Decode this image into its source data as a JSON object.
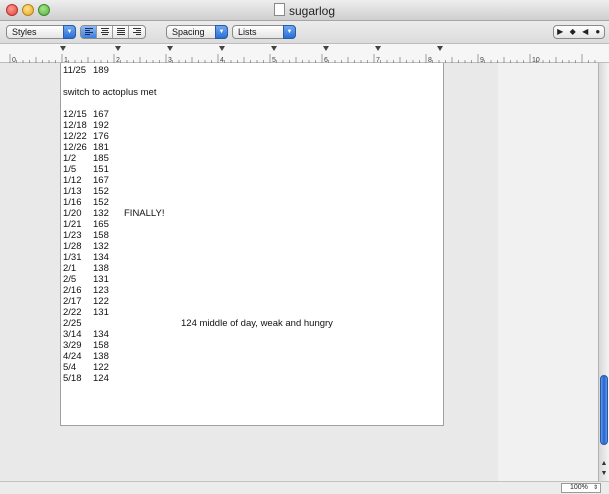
{
  "window": {
    "title": "sugarlog"
  },
  "toolbar": {
    "styles_label": "Styles",
    "spacing_label": "Spacing",
    "lists_label": "Lists",
    "nav_glyphs": [
      "▶",
      "◆",
      "◀",
      "●"
    ]
  },
  "ruler": {
    "labels": [
      "0",
      "1",
      "2",
      "3",
      "4",
      "5",
      "6",
      "7",
      "8",
      "9",
      "10"
    ]
  },
  "document": {
    "lines": [
      {
        "c1": "11/25",
        "c2": "189",
        "c3": ""
      },
      {
        "c1": "",
        "c2": "",
        "c3": ""
      },
      {
        "c1": "switch to actoplus met",
        "c2": "",
        "c3": ""
      },
      {
        "c1": "",
        "c2": "",
        "c3": ""
      },
      {
        "c1": "12/15",
        "c2": "167",
        "c3": ""
      },
      {
        "c1": "12/18",
        "c2": "192",
        "c3": ""
      },
      {
        "c1": "12/22",
        "c2": "176",
        "c3": ""
      },
      {
        "c1": "12/26",
        "c2": "181",
        "c3": ""
      },
      {
        "c1": "1/2",
        "c2": "185",
        "c3": ""
      },
      {
        "c1": "1/5",
        "c2": "151",
        "c3": ""
      },
      {
        "c1": "1/12",
        "c2": "167",
        "c3": ""
      },
      {
        "c1": "1/13",
        "c2": "152",
        "c3": ""
      },
      {
        "c1": "1/16",
        "c2": "152",
        "c3": ""
      },
      {
        "c1": "1/20",
        "c2": "132",
        "c3": "FINALLY!"
      },
      {
        "c1": "1/21",
        "c2": "165",
        "c3": ""
      },
      {
        "c1": "1/23",
        "c2": "158",
        "c3": ""
      },
      {
        "c1": "1/28",
        "c2": "132",
        "c3": ""
      },
      {
        "c1": "1/31",
        "c2": "134",
        "c3": ""
      },
      {
        "c1": "2/1",
        "c2": "138",
        "c3": ""
      },
      {
        "c1": "2/5",
        "c2": "131",
        "c3": ""
      },
      {
        "c1": "2/16",
        "c2": "123",
        "c3": ""
      },
      {
        "c1": "2/17",
        "c2": "122",
        "c3": ""
      },
      {
        "c1": "2/22",
        "c2": "131",
        "c3": ""
      },
      {
        "c1": "2/25",
        "c2": "",
        "c3": "",
        "c4": "124 middle of day, weak and hungry"
      },
      {
        "c1": "3/14",
        "c2": "134",
        "c3": ""
      },
      {
        "c1": "3/29",
        "c2": "158",
        "c3": ""
      },
      {
        "c1": "4/24",
        "c2": "138",
        "c3": ""
      },
      {
        "c1": "5/4",
        "c2": "122",
        "c3": ""
      },
      {
        "c1": "5/18",
        "c2": "124",
        "c3": ""
      }
    ]
  },
  "statusbar": {
    "zoom": "100%"
  }
}
